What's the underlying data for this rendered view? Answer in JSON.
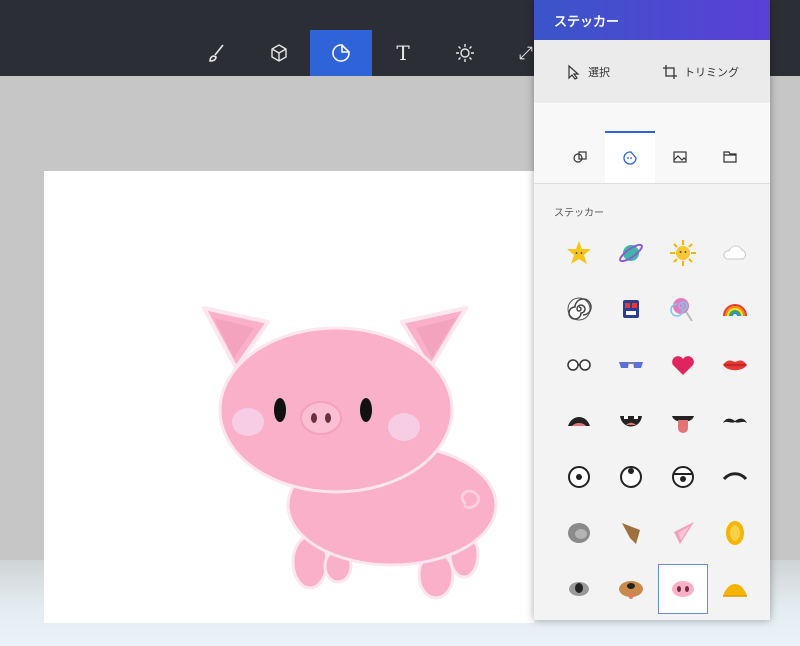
{
  "toolbar": {
    "tools": [
      {
        "name": "brush-tool",
        "icon": "brush-icon"
      },
      {
        "name": "3d-shapes-tool",
        "icon": "cube-icon"
      },
      {
        "name": "stickers-tool",
        "icon": "sticker-icon"
      },
      {
        "name": "text-tool",
        "icon": "text-icon",
        "glyph": "T"
      },
      {
        "name": "effects-tool",
        "icon": "sun-icon"
      },
      {
        "name": "canvas-tool",
        "icon": "resize-icon"
      }
    ],
    "active_tool": "stickers-tool"
  },
  "panel": {
    "title": "ステッカー",
    "actions": {
      "select_label": "選択",
      "trim_label": "トリミング"
    },
    "tabs": [
      {
        "name": "tab-shapes",
        "icon": "shapes-icon"
      },
      {
        "name": "tab-stickers",
        "icon": "sticker-icon"
      },
      {
        "name": "tab-textures",
        "icon": "image-icon"
      },
      {
        "name": "tab-folder",
        "icon": "folder-icon"
      }
    ],
    "active_tab": "tab-stickers",
    "section_title": "ステッカー",
    "stickers": [
      "star-face-sticker",
      "planet-sticker",
      "sun-face-sticker",
      "cloud-sticker",
      "spiral-sticker",
      "robot-face-sticker",
      "lollipop-sticker",
      "rainbow-sticker",
      "glasses-sticker",
      "sunglasses-sticker",
      "heart-sticker",
      "lips-sticker",
      "open-mouth-sticker",
      "smile-mouth-sticker",
      "tongue-sticker",
      "mustache-sticker",
      "eye-sticker",
      "eye-up-sticker",
      "eye-sleepy-sticker",
      "eyebrow-sticker",
      "grey-ear-sticker",
      "brown-ear-sticker",
      "pink-ear-sticker",
      "yellow-ear-sticker",
      "koala-nose-sticker",
      "dog-nose-sticker",
      "pig-nose-sticker",
      "duck-beak-sticker"
    ],
    "selected_sticker": "pig-nose-sticker"
  },
  "colors": {
    "accent": "#2f63d8",
    "pig_pink": "#f9b0c8",
    "cheek": "#f6cde4"
  }
}
